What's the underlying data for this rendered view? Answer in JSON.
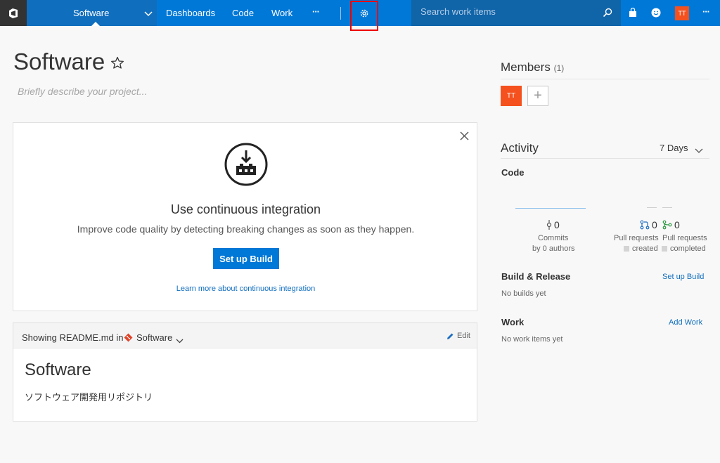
{
  "topbar": {
    "project_name": "Software",
    "nav": [
      "Dashboards",
      "Code",
      "Work"
    ],
    "more_label": "···",
    "search_placeholder": "Search work items",
    "user_initials": "TT"
  },
  "project": {
    "title": "Software",
    "description_placeholder": "Briefly describe your project..."
  },
  "ci_card": {
    "title": "Use continuous integration",
    "subtitle": "Improve code quality by detecting breaking changes as soon as they happen.",
    "button": "Set up Build",
    "link": "Learn more about continuous integration"
  },
  "readme": {
    "showing_label": "Showing README.md in",
    "repo": "Software",
    "edit_label": "Edit",
    "heading": "Software",
    "body": "ソフトウェア開発用リポジトリ"
  },
  "members": {
    "title": "Members",
    "count": "(1)",
    "avatar_initials": "TT",
    "add_label": "+"
  },
  "activity": {
    "title": "Activity",
    "range": "7 Days",
    "code_label": "Code",
    "commits_value": "0",
    "commits_label": "Commits",
    "commits_authors": "by 0 authors",
    "pr_created_value": "0",
    "pr_completed_value": "0",
    "pr_label": "Pull requests",
    "pr_created": "created",
    "pr_completed": "completed",
    "build_label": "Build & Release",
    "build_action": "Set up Build",
    "build_status": "No builds yet",
    "work_label": "Work",
    "work_action": "Add Work",
    "work_status": "No work items yet"
  },
  "colors": {
    "accent": "#0078d7",
    "highlight": "#e00000",
    "avatar": "#f4511e"
  }
}
